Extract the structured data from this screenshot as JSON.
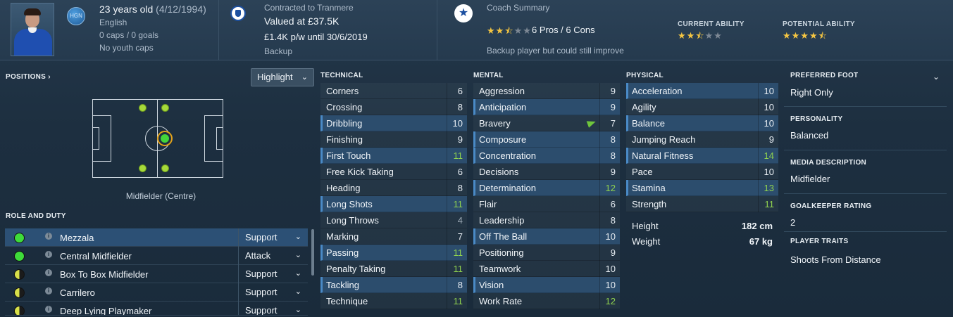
{
  "header": {
    "age_text": "23 years old",
    "dob_text": "(4/12/1994)",
    "nation_code": "HGN",
    "nationality": "English",
    "caps": "0 caps / 0 goals",
    "youth_caps": "No youth caps",
    "contract_label": "Contracted to Tranmere",
    "value": "Valued at £37.5K",
    "wage": "£1.4K p/w until 30/6/2019",
    "squad_status": "Backup",
    "coach_title": "Coach Summary",
    "coach_rating_stars": 2.5,
    "pros_cons": "6 Pros / 6 Cons",
    "coach_comment": "Backup player but could still improve",
    "current_ability_label": "CURRENT ABILITY",
    "current_ability_stars": 2.5,
    "potential_ability_label": "POTENTIAL ABILITY",
    "potential_ability_stars": 4.5
  },
  "positions": {
    "title": "POSITIONS",
    "highlight_label": "Highlight",
    "caption": "Midfielder (Centre)"
  },
  "roles": {
    "title": "ROLE AND DUTY",
    "items": [
      {
        "name": "Mezzala",
        "duty": "Support",
        "suitability": "full"
      },
      {
        "name": "Central Midfielder",
        "duty": "Attack",
        "suitability": "full"
      },
      {
        "name": "Box To Box Midfielder",
        "duty": "Support",
        "suitability": "half"
      },
      {
        "name": "Carrilero",
        "duty": "Support",
        "suitability": "half"
      },
      {
        "name": "Deep Lying Playmaker",
        "duty": "Support",
        "suitability": "half"
      }
    ]
  },
  "technical": {
    "title": "TECHNICAL",
    "items": [
      {
        "name": "Corners",
        "value": "6"
      },
      {
        "name": "Crossing",
        "value": "8"
      },
      {
        "name": "Dribbling",
        "value": "10"
      },
      {
        "name": "Finishing",
        "value": "9"
      },
      {
        "name": "First Touch",
        "value": "11"
      },
      {
        "name": "Free Kick Taking",
        "value": "6"
      },
      {
        "name": "Heading",
        "value": "8"
      },
      {
        "name": "Long Shots",
        "value": "11"
      },
      {
        "name": "Long Throws",
        "value": "4"
      },
      {
        "name": "Marking",
        "value": "7"
      },
      {
        "name": "Passing",
        "value": "11"
      },
      {
        "name": "Penalty Taking",
        "value": "11"
      },
      {
        "name": "Tackling",
        "value": "8"
      },
      {
        "name": "Technique",
        "value": "11"
      }
    ]
  },
  "mental": {
    "title": "MENTAL",
    "items": [
      {
        "name": "Aggression",
        "value": "9"
      },
      {
        "name": "Anticipation",
        "value": "9"
      },
      {
        "name": "Bravery",
        "value": "7"
      },
      {
        "name": "Composure",
        "value": "8"
      },
      {
        "name": "Concentration",
        "value": "8"
      },
      {
        "name": "Decisions",
        "value": "9"
      },
      {
        "name": "Determination",
        "value": "12"
      },
      {
        "name": "Flair",
        "value": "6"
      },
      {
        "name": "Leadership",
        "value": "8"
      },
      {
        "name": "Off The Ball",
        "value": "10"
      },
      {
        "name": "Positioning",
        "value": "9"
      },
      {
        "name": "Teamwork",
        "value": "10"
      },
      {
        "name": "Vision",
        "value": "10"
      },
      {
        "name": "Work Rate",
        "value": "12"
      }
    ]
  },
  "physical": {
    "title": "PHYSICAL",
    "items": [
      {
        "name": "Acceleration",
        "value": "10"
      },
      {
        "name": "Agility",
        "value": "10"
      },
      {
        "name": "Balance",
        "value": "10"
      },
      {
        "name": "Jumping Reach",
        "value": "9"
      },
      {
        "name": "Natural Fitness",
        "value": "14"
      },
      {
        "name": "Pace",
        "value": "10"
      },
      {
        "name": "Stamina",
        "value": "13"
      },
      {
        "name": "Strength",
        "value": "11"
      }
    ],
    "height_label": "Height",
    "height_value": "182 cm",
    "weight_label": "Weight",
    "weight_value": "67 kg"
  },
  "info": {
    "preferred_foot_label": "PREFERRED FOOT",
    "preferred_foot": "Right Only",
    "personality_label": "PERSONALITY",
    "personality": "Balanced",
    "media_label": "MEDIA DESCRIPTION",
    "media": "Midfielder",
    "gk_label": "GOALKEEPER RATING",
    "gk_rating": "2",
    "traits_label": "PLAYER TRAITS",
    "traits": "Shoots From Distance"
  }
}
